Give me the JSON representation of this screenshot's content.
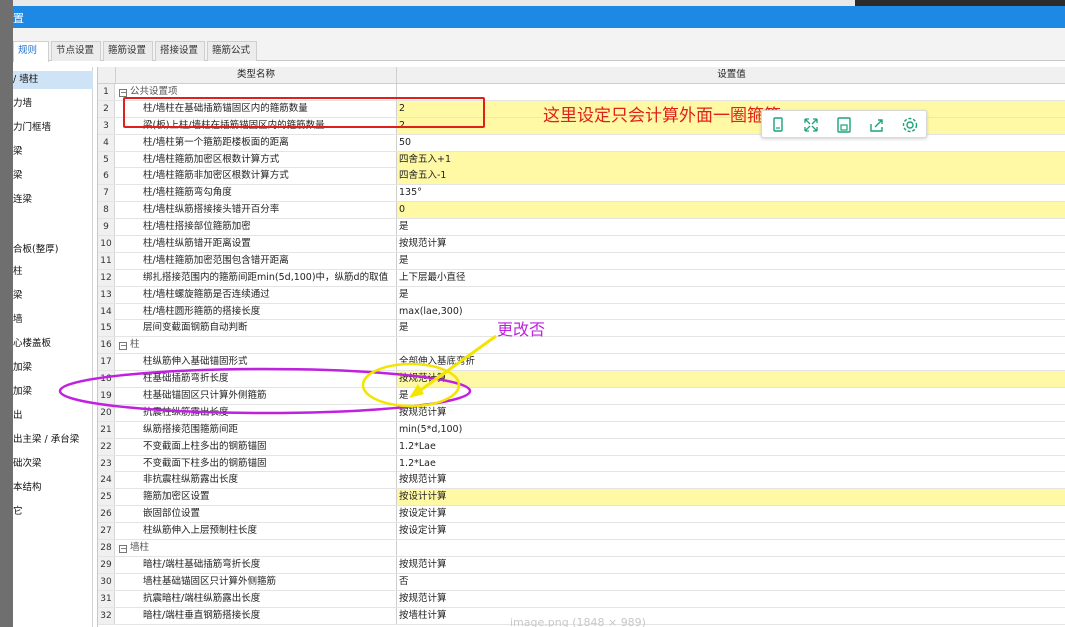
{
  "window": {
    "title": "置"
  },
  "tabs": [
    "规则",
    "节点设置",
    "箍筋设置",
    "搭接设置",
    "箍筋公式"
  ],
  "sidebar": {
    "items": [
      "/ 墙柱",
      "力墙",
      "力门框墙",
      "梁",
      "梁",
      "连梁",
      "",
      "合板(整厚)",
      "柱",
      "梁",
      "墙",
      "心楼盖板",
      "加梁",
      "加梁",
      "出",
      "出主梁 / 承台梁",
      "础次梁",
      "本结构",
      "它"
    ]
  },
  "table": {
    "headers": {
      "name": "类型名称",
      "value": "设置值"
    },
    "rows": [
      {
        "num": "1",
        "name": "公共设置项",
        "value": "",
        "group": true,
        "hl": false
      },
      {
        "num": "2",
        "name": "柱/墙柱在基础插筋锚固区内的箍筋数量",
        "value": "2",
        "group": false,
        "hl": true
      },
      {
        "num": "3",
        "name": "梁(板)上柱/墙柱在插筋锚固区内的箍筋数量",
        "value": "2",
        "group": false,
        "hl": true
      },
      {
        "num": "4",
        "name": "柱/墙柱第一个箍筋距楼板面的距离",
        "value": "50",
        "group": false,
        "hl": false
      },
      {
        "num": "5",
        "name": "柱/墙柱箍筋加密区根数计算方式",
        "value": "四舍五入+1",
        "group": false,
        "hl": true
      },
      {
        "num": "6",
        "name": "柱/墙柱箍筋非加密区根数计算方式",
        "value": "四舍五入-1",
        "group": false,
        "hl": true
      },
      {
        "num": "7",
        "name": "柱/墙柱箍筋弯勾角度",
        "value": "135°",
        "group": false,
        "hl": false
      },
      {
        "num": "8",
        "name": "柱/墙柱纵筋搭接接头错开百分率",
        "value": "0",
        "group": false,
        "hl": true
      },
      {
        "num": "9",
        "name": "柱/墙柱搭接部位箍筋加密",
        "value": "是",
        "group": false,
        "hl": false
      },
      {
        "num": "10",
        "name": "柱/墙柱纵筋错开距离设置",
        "value": "按规范计算",
        "group": false,
        "hl": false
      },
      {
        "num": "11",
        "name": "柱/墙柱箍筋加密范围包含错开距离",
        "value": "是",
        "group": false,
        "hl": false
      },
      {
        "num": "12",
        "name": "绑扎搭接范围内的箍筋间距min(5d,100)中，纵筋d的取值",
        "value": "上下层最小直径",
        "group": false,
        "hl": false
      },
      {
        "num": "13",
        "name": "柱/墙柱螺旋箍筋是否连续通过",
        "value": "是",
        "group": false,
        "hl": false
      },
      {
        "num": "14",
        "name": "柱/墙柱圆形箍筋的搭接长度",
        "value": "max(lae,300)",
        "group": false,
        "hl": false
      },
      {
        "num": "15",
        "name": "层间变截面钢筋自动判断",
        "value": "是",
        "group": false,
        "hl": false
      },
      {
        "num": "16",
        "name": "柱",
        "value": "",
        "group": true,
        "hl": false
      },
      {
        "num": "17",
        "name": "柱纵筋伸入基础锚固形式",
        "value": "全部伸入基底弯折",
        "group": false,
        "hl": false
      },
      {
        "num": "18",
        "name": "柱基础插筋弯折长度",
        "value": "按规范计算",
        "group": false,
        "hl": true
      },
      {
        "num": "19",
        "name": "柱基础锚固区只计算外侧箍筋",
        "value": "是",
        "group": false,
        "hl": false
      },
      {
        "num": "20",
        "name": "抗震柱纵筋露出长度",
        "value": "按规范计算",
        "group": false,
        "hl": false
      },
      {
        "num": "21",
        "name": "纵筋搭接范围箍筋间距",
        "value": "min(5*d,100)",
        "group": false,
        "hl": false
      },
      {
        "num": "22",
        "name": "不变截面上柱多出的钢筋锚固",
        "value": "1.2*Lae",
        "group": false,
        "hl": false
      },
      {
        "num": "23",
        "name": "不变截面下柱多出的钢筋锚固",
        "value": "1.2*Lae",
        "group": false,
        "hl": false
      },
      {
        "num": "24",
        "name": "非抗震柱纵筋露出长度",
        "value": "按规范计算",
        "group": false,
        "hl": false
      },
      {
        "num": "25",
        "name": "箍筋加密区设置",
        "value": "按设计计算",
        "group": false,
        "hl": true
      },
      {
        "num": "26",
        "name": "嵌固部位设置",
        "value": "按设定计算",
        "group": false,
        "hl": false
      },
      {
        "num": "27",
        "name": "柱纵筋伸入上层预制柱长度",
        "value": "按设定计算",
        "group": false,
        "hl": false
      },
      {
        "num": "28",
        "name": "墙柱",
        "value": "",
        "group": true,
        "hl": false
      },
      {
        "num": "29",
        "name": "暗柱/端柱基础插筋弯折长度",
        "value": "按规范计算",
        "group": false,
        "hl": false
      },
      {
        "num": "30",
        "name": "墙柱基础锚固区只计算外侧箍筋",
        "value": "否",
        "group": false,
        "hl": false
      },
      {
        "num": "31",
        "name": "抗震暗柱/端柱纵筋露出长度",
        "value": "按规范计算",
        "group": false,
        "hl": false
      },
      {
        "num": "32",
        "name": "暗柱/端柱垂直钢筋搭接长度",
        "value": "按墙柱计算",
        "group": false,
        "hl": false
      }
    ]
  },
  "annotations": {
    "red_note": "这里设定只会计算外面一圈箍筋",
    "magenta_note": "更改否"
  },
  "floating_toolbar": {
    "icons": [
      "phone-icon",
      "expand-icon",
      "save-icon",
      "share-icon",
      "settings-icon"
    ]
  },
  "caption": "image.png (1848 × 989)",
  "colors": {
    "titlebar": "#1e88e5",
    "highlight": "#fff9a6",
    "annotation_red": "#e0201a",
    "annotation_magenta": "#c020e0",
    "annotation_yellow": "#f2e600"
  }
}
